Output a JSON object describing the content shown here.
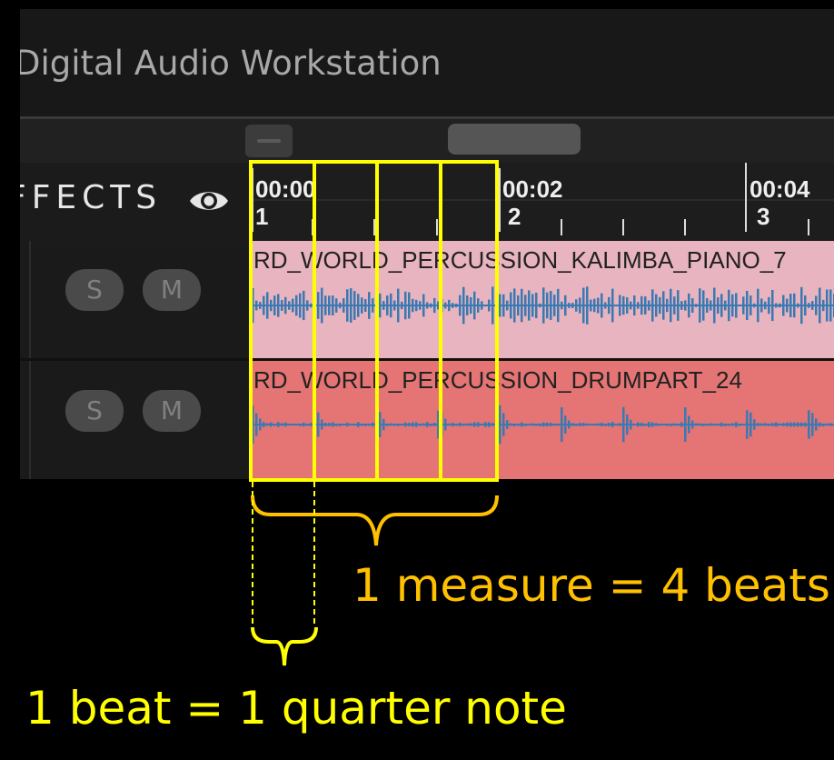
{
  "app": {
    "title": "Digital Audio Workstation"
  },
  "panel": {
    "effects_label": "FFECTS"
  },
  "ruler": {
    "markers": [
      {
        "time": "00:00",
        "bar": "1"
      },
      {
        "time": "00:02",
        "bar": "2"
      },
      {
        "time": "00:04",
        "bar": "3"
      }
    ]
  },
  "tracks": [
    {
      "solo_label": "S",
      "mute_label": "M",
      "clip_name": "RD_WORLD_PERCUSSION_KALIMBA_PIANO_7",
      "clip_color": "#e8b4bf",
      "wave_color": "#3a79b2"
    },
    {
      "solo_label": "S",
      "mute_label": "M",
      "clip_name": "RD_WORLD_PERCUSSION_DRUMPART_24",
      "clip_color": "#e57474",
      "wave_color": "#3a79b2"
    }
  ],
  "annotations": {
    "measure_label": "1 measure = 4 beats",
    "beat_label": "1 beat = 1 quarter note",
    "measure_color": "#ffc000",
    "beat_color": "#ffff00"
  }
}
